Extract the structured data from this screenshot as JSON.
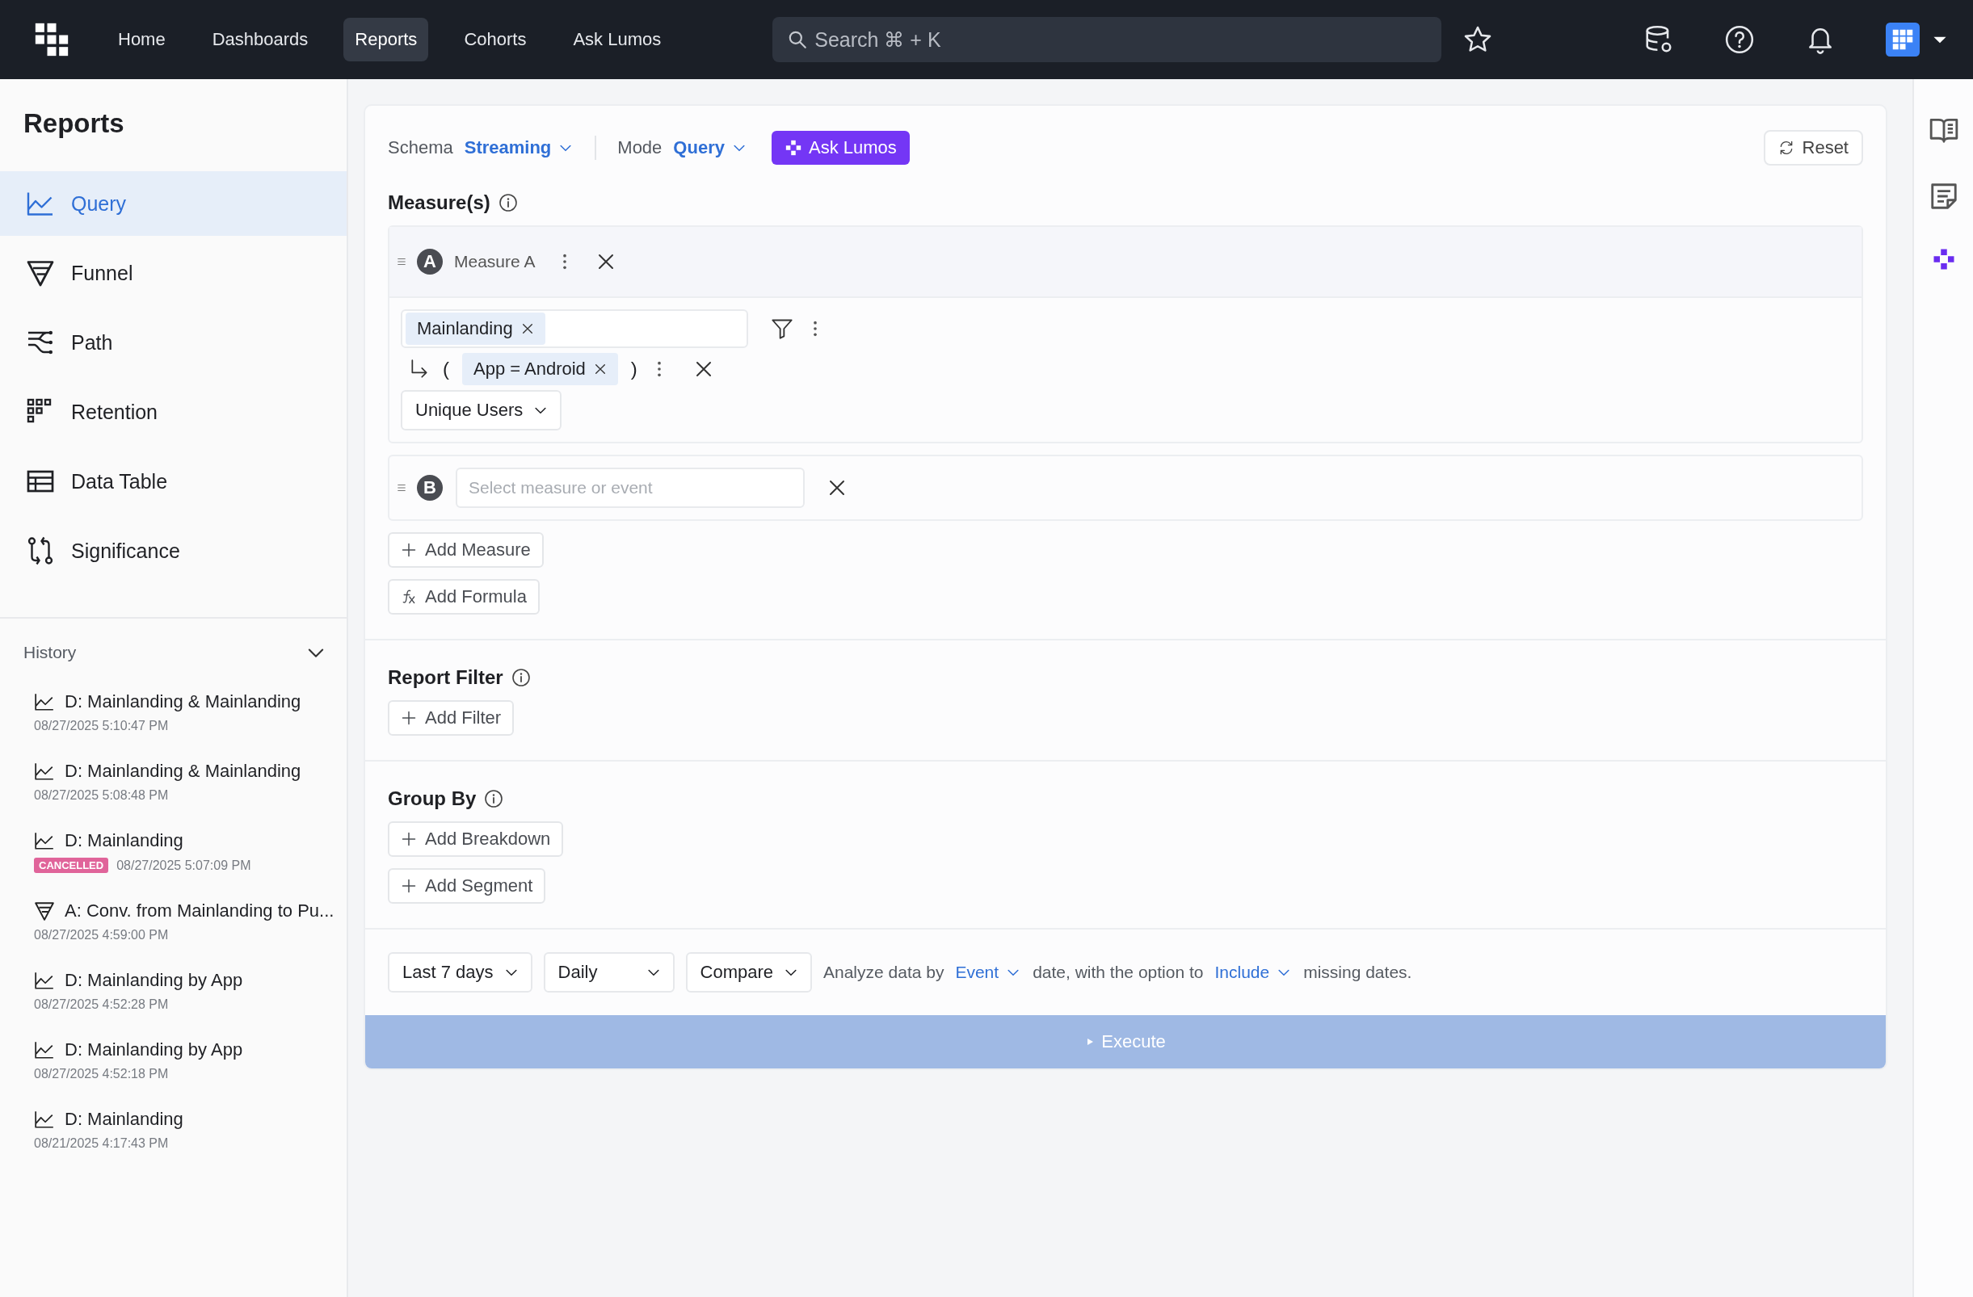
{
  "topbar": {
    "nav": [
      {
        "label": "Home",
        "selected": false
      },
      {
        "label": "Dashboards",
        "selected": false
      },
      {
        "label": "Reports",
        "selected": true
      },
      {
        "label": "Cohorts",
        "selected": false
      },
      {
        "label": "Ask Lumos",
        "selected": false
      }
    ],
    "search": {
      "placeholder": "Search ⌘ + K"
    }
  },
  "sidebar": {
    "title": "Reports",
    "items": [
      {
        "label": "Query",
        "kind": "query",
        "selected": true
      },
      {
        "label": "Funnel",
        "kind": "funnel",
        "selected": false
      },
      {
        "label": "Path",
        "kind": "path",
        "selected": false
      },
      {
        "label": "Retention",
        "kind": "retention",
        "selected": false
      },
      {
        "label": "Data Table",
        "kind": "table",
        "selected": false
      },
      {
        "label": "Significance",
        "kind": "significance",
        "selected": false
      }
    ],
    "history": {
      "label": "History",
      "expanded": true,
      "items": [
        {
          "title": "D: Mainlanding & Mainlanding",
          "kind": "query",
          "time": "08/27/2025 5:10:47 PM"
        },
        {
          "title": "D: Mainlanding & Mainlanding",
          "kind": "query",
          "time": "08/27/2025 5:08:48 PM"
        },
        {
          "title": "D: Mainlanding",
          "kind": "query",
          "status": "CANCELLED",
          "time": "08/27/2025 5:07:09 PM"
        },
        {
          "title": "A: Conv. from Mainlanding to Pu...",
          "kind": "funnel",
          "time": "08/27/2025 4:59:00 PM"
        },
        {
          "title": "D: Mainlanding by App",
          "kind": "query",
          "time": "08/27/2025 4:52:28 PM"
        },
        {
          "title": "D: Mainlanding by App",
          "kind": "query",
          "time": "08/27/2025 4:52:18 PM"
        },
        {
          "title": "D: Mainlanding",
          "kind": "query",
          "time": "08/21/2025 4:17:43 PM"
        }
      ]
    }
  },
  "toolbar": {
    "schema": {
      "label": "Schema",
      "value": "Streaming"
    },
    "mode": {
      "label": "Mode",
      "value": "Query"
    },
    "ask_button": "Ask Lumos",
    "reset_button": "Reset"
  },
  "measures": {
    "heading": "Measure(s)",
    "items": [
      {
        "kind": "filled",
        "letter": "A",
        "name": "Measure A",
        "event": "Mainlanding",
        "open_paren": "(",
        "filter": "App = Android",
        "close_paren": ")",
        "aggregation": "Unique Users"
      },
      {
        "kind": "empty",
        "letter": "B",
        "placeholder": "Select measure or event"
      }
    ],
    "buttons": [
      {
        "label": "Add Measure",
        "kind": "add"
      },
      {
        "label": "Add Formula",
        "kind": "formula"
      }
    ]
  },
  "report_filter": {
    "heading": "Report Filter",
    "buttons": [
      {
        "label": "Add Filter",
        "kind": "add"
      }
    ]
  },
  "group_by": {
    "heading": "Group By",
    "buttons": [
      {
        "label": "Add Breakdown",
        "kind": "add"
      },
      {
        "label": "Add Segment",
        "kind": "add"
      }
    ]
  },
  "footer": {
    "range": "Last 7 days",
    "interval": "Daily",
    "compare": "Compare",
    "text_1": "Analyze data by",
    "date_option": "Event",
    "text_2": "date, with the option to",
    "missing_option": "Include",
    "text_3": "missing dates."
  },
  "execute": {
    "label": "Execute",
    "disabled": true
  }
}
